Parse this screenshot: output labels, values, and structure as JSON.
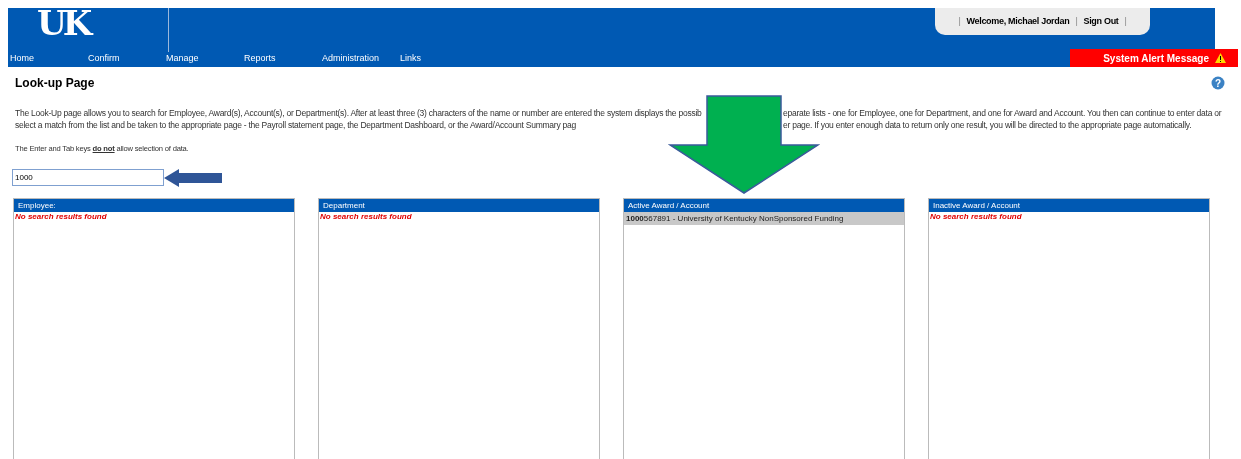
{
  "header": {
    "logo": "UK",
    "nav": [
      {
        "label": "Home"
      },
      {
        "label": "Confirm"
      },
      {
        "label": "Manage"
      },
      {
        "label": "Reports"
      },
      {
        "label": "Administration"
      },
      {
        "label": "Links"
      }
    ],
    "user_bar": {
      "separator": "|",
      "welcome": "Welcome, Michael Jordan",
      "sign_out": "Sign Out"
    },
    "alert": "System Alert Message"
  },
  "page_title": "Look-up Page",
  "help_icon": "?",
  "description": {
    "lines": [
      {
        "left": "The Look-Up page allows you to search for Employee, Award(s), Account(s), or Department(s). After at least three (3) characters of the name or number are entered the system displays the possib",
        "right": "eparate lists - one for Employee, one for Department, and one for Award and Account. You then can continue to enter data or"
      },
      {
        "left": "select a match from the list and be taken to the appropriate page - the Payroll statement page, the Department Dashboard, or the Award/Account Summary pag",
        "right": "er page. If you enter enough data to return only one result, you will be directed to the appropriate page automatically."
      }
    ]
  },
  "note": "The Enter and Tab keys **do not** allow selection of data.",
  "search": {
    "value": "1000"
  },
  "panels": [
    {
      "title": "Employee:",
      "empty": "No search results found"
    },
    {
      "title": "Department",
      "empty": "No search results found"
    },
    {
      "title": "Active Award / Account",
      "results": [
        "**1000**567891 - University of Kentucky NonSponsored Funding"
      ]
    },
    {
      "title": "Inactive Award / Account",
      "empty": "No search results found"
    }
  ]
}
